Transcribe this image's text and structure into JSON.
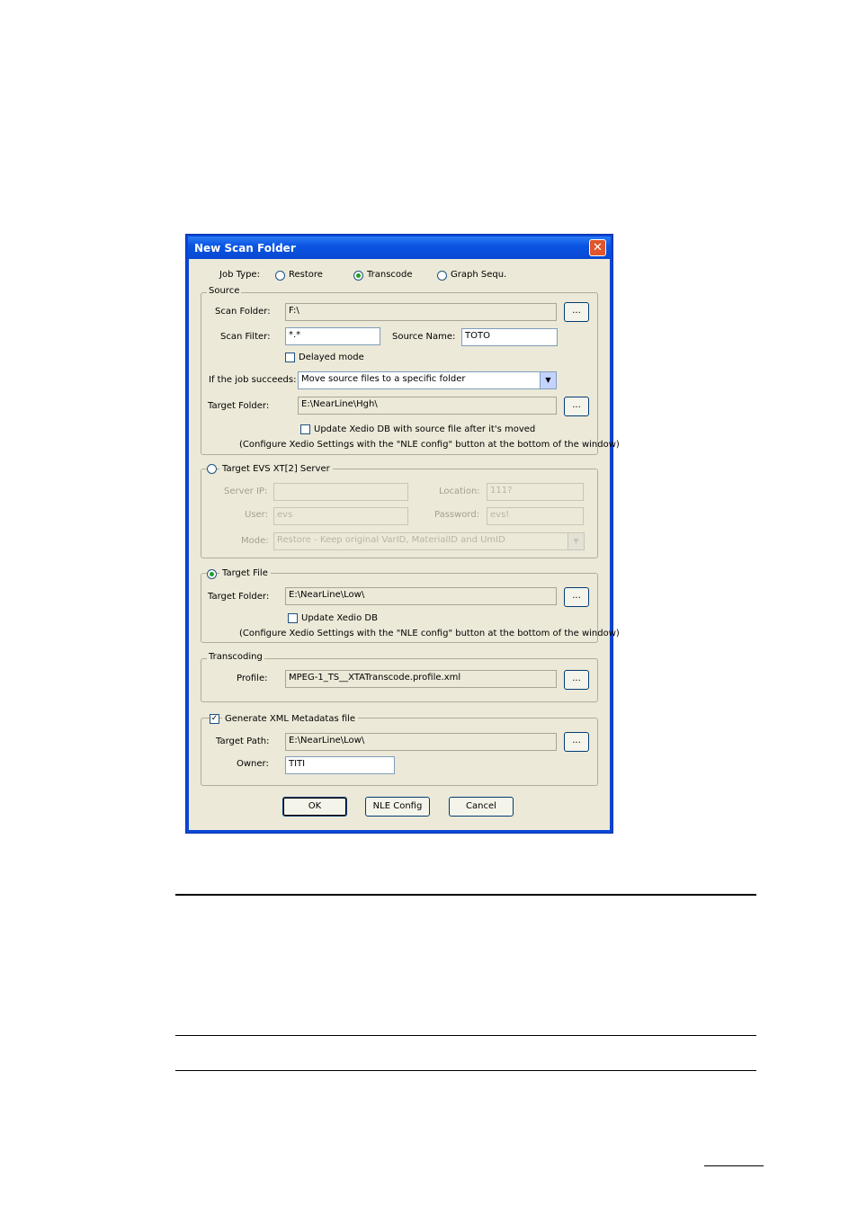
{
  "dialog": {
    "title": "New Scan Folder",
    "close_glyph": "✕",
    "job_type": {
      "label": "Job Type:",
      "options": [
        "Restore",
        "Transcode",
        "Graph Sequ."
      ],
      "selected": "Transcode"
    },
    "source": {
      "legend": "Source",
      "scan_folder_label": "Scan Folder:",
      "scan_folder_value": "F:\\",
      "scan_filter_label": "Scan Filter:",
      "scan_filter_value": "*.*",
      "source_name_label": "Source Name:",
      "source_name_value": "TOTO",
      "delayed_mode_label": "Delayed mode",
      "if_job_succeeds_label": "If the job succeeds:",
      "if_job_succeeds_value": "Move source files to a specific folder",
      "target_folder_label": "Target Folder:",
      "target_folder_value": "E:\\NearLine\\Hgh\\",
      "update_db_label": "Update Xedio DB with source file after it's moved",
      "configure_note": "(Configure Xedio Settings with the \"NLE config\" button at the bottom of the window)"
    },
    "target_evs": {
      "legend": "Target EVS XT[2] Server",
      "server_ip_label": "Server IP:",
      "server_ip_value": "",
      "location_label": "Location:",
      "location_value": "111?",
      "user_label": "User:",
      "user_value": "evs",
      "password_label": "Password:",
      "password_value": "evs!",
      "mode_label": "Mode:",
      "mode_value": "Restore - Keep original VarID, MaterialID and UmID"
    },
    "target_file": {
      "legend": "Target File",
      "target_folder_label": "Target Folder:",
      "target_folder_value": "E:\\NearLine\\Low\\",
      "update_db_label": "Update Xedio DB",
      "configure_note": "(Configure Xedio Settings with the \"NLE config\" button at the bottom of the window)"
    },
    "transcoding": {
      "legend": "Transcoding",
      "profile_label": "Profile:",
      "profile_value": "MPEG-1_TS__XTATranscode.profile.xml"
    },
    "xml_metadata": {
      "legend": "Generate XML Metadatas file",
      "checked": true,
      "target_path_label": "Target Path:",
      "target_path_value": "E:\\NearLine\\Low\\",
      "owner_label": "Owner:",
      "owner_value": "TITI"
    },
    "browse_label": "...",
    "buttons": {
      "ok": "OK",
      "nle_config": "NLE Config",
      "cancel": "Cancel"
    },
    "check_glyph": "✓",
    "dropdown_glyph": "▼"
  }
}
